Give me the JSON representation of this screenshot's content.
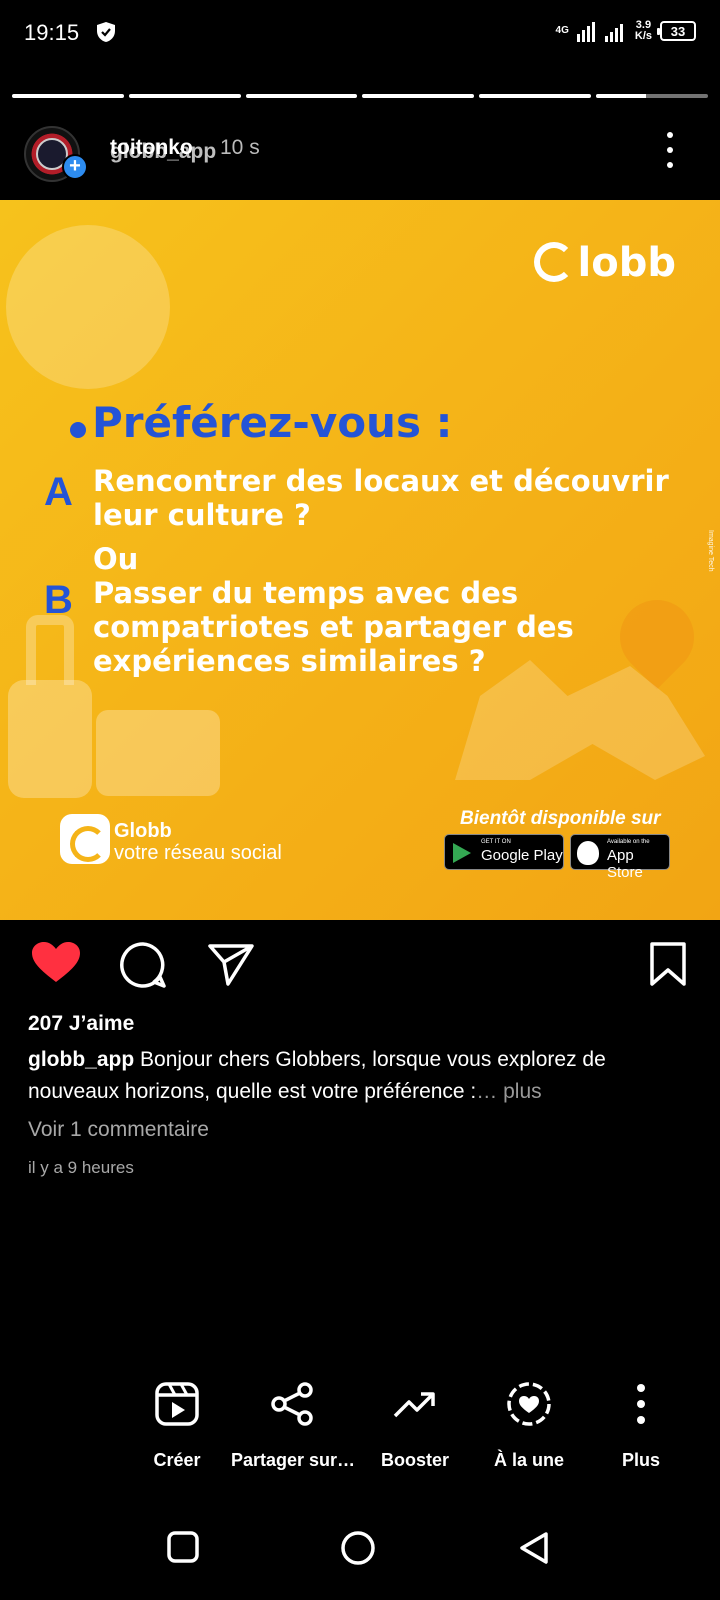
{
  "status_bar": {
    "time": "19:15",
    "network": "4G",
    "speed": "3.9\nK/s",
    "battery": "33"
  },
  "story_progress": [
    1,
    1,
    1,
    1,
    1,
    0.45
  ],
  "header": {
    "username_top": "toitonko",
    "username_overlay": "globb_app",
    "time_ago": "10 s"
  },
  "post": {
    "brand": "lobb",
    "question": "Préférez-vous :",
    "option_a_letter": "A",
    "option_a": "Rencontrer des locaux et découvrir leur culture ?",
    "or_text": "Ou",
    "option_b_letter": "B",
    "option_b": "Passer du temps avec des compatriotes et partager des expériences similaires ?",
    "app_name": "Globb",
    "app_tagline": "votre réseau social",
    "coming_soon": "Bientôt disponible sur",
    "google_small": "GET IT ON",
    "google_big": "Google Play",
    "apple_small": "Available on the",
    "apple_big": "App Store",
    "side_mark": "Imagine Tech"
  },
  "engagement": {
    "likes": "207 J’aime",
    "caption_user": "globb_app",
    "caption_text": " Bonjour chers Globbers, lorsque vous explorez de nouveaux horizons, quelle est votre préférence :",
    "caption_more": "… plus",
    "view_comments": "Voir 1 commentaire",
    "posted_ago": "il y a 9 heures"
  },
  "toolbar": [
    {
      "label": "Créer",
      "icon": "reels-icon"
    },
    {
      "label": "Partager sur…",
      "icon": "share-icon"
    },
    {
      "label": "Booster",
      "icon": "trend-up-icon"
    },
    {
      "label": "À la une",
      "icon": "highlight-heart-icon"
    },
    {
      "label": "Plus",
      "icon": "more-vertical-icon"
    }
  ],
  "colors": {
    "accent_blue": "#2454d6",
    "post_yellow": "#f5b418",
    "like_red": "#ff3040"
  }
}
